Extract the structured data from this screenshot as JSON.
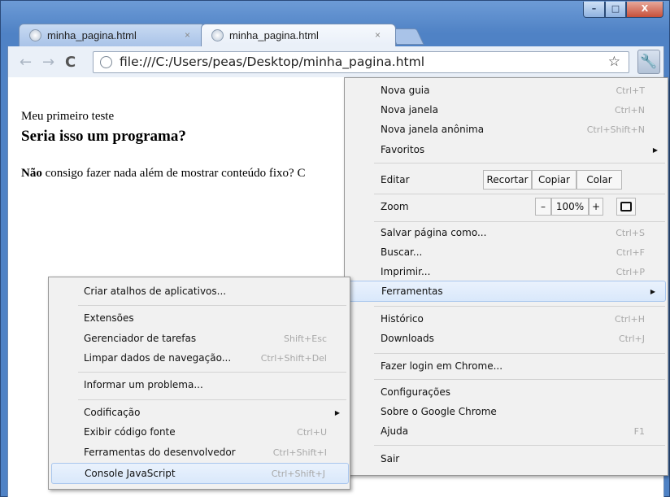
{
  "window": {
    "controls": {
      "minimize": "–",
      "maximize": "□",
      "close": "X"
    }
  },
  "tabs": [
    {
      "title": "minha_pagina.html",
      "close": "×",
      "active": false
    },
    {
      "title": "minha_pagina.html",
      "close": "×",
      "active": true
    }
  ],
  "toolbar": {
    "back_icon": "←",
    "forward_icon": "→",
    "reload_icon": "C",
    "url": "file:///C:/Users/peas/Desktop/minha_pagina.html",
    "star_icon": "☆",
    "wrench_icon": "🔧"
  },
  "page": {
    "paragraph1": "Meu primeiro teste",
    "heading": "Seria isso um programa?",
    "paragraph2_bold": "Não",
    "paragraph2_rest": " consigo fazer nada além de mostrar conteúdo fixo? C"
  },
  "main_menu": {
    "items": [
      {
        "label": "Nova guia",
        "shortcut": "Ctrl+T"
      },
      {
        "label": "Nova janela",
        "shortcut": "Ctrl+N"
      },
      {
        "label": "Nova janela anônima",
        "shortcut": "Ctrl+Shift+N"
      },
      {
        "label": "Favoritos",
        "shortcut": ""
      }
    ],
    "edit": {
      "label": "Editar",
      "cut": "Recortar",
      "copy": "Copiar",
      "paste": "Colar"
    },
    "zoom": {
      "label": "Zoom",
      "minus": "–",
      "level": "100%",
      "plus": "+"
    },
    "items2": [
      {
        "label": "Salvar página como...",
        "shortcut": "Ctrl+S"
      },
      {
        "label": "Buscar...",
        "shortcut": "Ctrl+F"
      },
      {
        "label": "Imprimir...",
        "shortcut": "Ctrl+P"
      },
      {
        "label": "Ferramentas",
        "shortcut": ""
      },
      {
        "label": "Histórico",
        "shortcut": "Ctrl+H"
      },
      {
        "label": "Downloads",
        "shortcut": "Ctrl+J"
      },
      {
        "label": "Fazer login em Chrome...",
        "shortcut": ""
      },
      {
        "label": "Configurações",
        "shortcut": ""
      },
      {
        "label": "Sobre o Google Chrome",
        "shortcut": ""
      },
      {
        "label": "Ajuda",
        "shortcut": "F1"
      },
      {
        "label": "Sair",
        "shortcut": ""
      }
    ]
  },
  "tools_menu": {
    "items": [
      {
        "label": "Criar atalhos de aplicativos...",
        "shortcut": ""
      },
      {
        "label": "Extensões",
        "shortcut": ""
      },
      {
        "label": "Gerenciador de tarefas",
        "shortcut": "Shift+Esc"
      },
      {
        "label": "Limpar dados de navegação...",
        "shortcut": "Ctrl+Shift+Del"
      },
      {
        "label": "Informar um problema...",
        "shortcut": ""
      },
      {
        "label": "Codificação",
        "shortcut": ""
      },
      {
        "label": "Exibir código fonte",
        "shortcut": "Ctrl+U"
      },
      {
        "label": "Ferramentas do desenvolvedor",
        "shortcut": "Ctrl+Shift+I"
      },
      {
        "label": "Console JavaScript",
        "shortcut": "Ctrl+Shift+J"
      }
    ]
  },
  "submenu_arrow": "▶"
}
